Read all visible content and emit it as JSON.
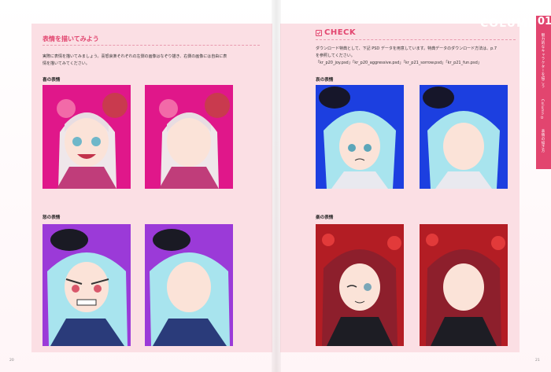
{
  "left_page": {
    "heading": "表情を描いてみよう",
    "intro_line1": "実際に表情を描いてみましょう。喜怒哀楽それぞれの左側の画像はなぞり描き、右側の画像には自由に表",
    "intro_line2": "情を描いてみてください。",
    "joy_label": "喜の表情",
    "anger_label": "怒の表情",
    "page_number": "20"
  },
  "right_page": {
    "check_title": "CHECK",
    "check_line1": "ダウンロード特典として、下記 PSD データを用意しています。特典データのダウンロード方法は、p.7",
    "check_line2": "を参照してください。",
    "check_line3": "「kr_p20_joy.psd」「kr_p20_aggressive.psd」「kr_p21_sorrow.psd」「kr_p21_fun.psd」",
    "sorrow_label": "哀の表情",
    "fun_label": "楽の表情",
    "column_watermark": "COLUMN",
    "page_number": "21"
  },
  "side_tab": {
    "chapter_number": "01",
    "chapter_title": "魅力的なキャラクターを描こう",
    "section_label": "Column ②",
    "section_title": "表情の描き方"
  },
  "colors": {
    "accent": "#e2456f",
    "panel_bg": "#fbdfe4",
    "joy_bg": "#e0178a",
    "anger_bg": "#9b3ad8",
    "sorrow_bg": "#1c3fe0",
    "fun_bg": "#b31d24"
  }
}
